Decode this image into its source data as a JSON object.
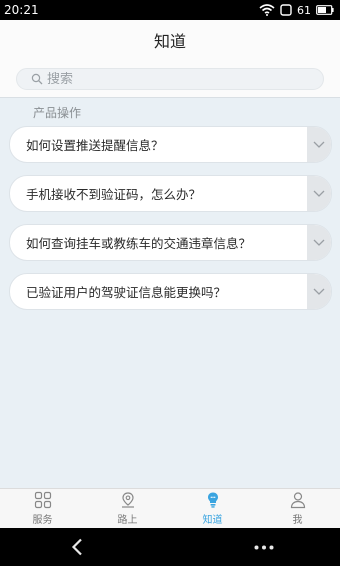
{
  "status_bar": {
    "time": "20:21",
    "battery": "61",
    "icons": [
      "wifi-icon",
      "screen-icon",
      "battery-icon"
    ]
  },
  "header": {
    "title": "知道"
  },
  "search": {
    "placeholder": "搜索",
    "icon": "search-icon"
  },
  "section": {
    "label": "产品操作"
  },
  "faq": [
    {
      "question": "如何设置推送提醒信息？"
    },
    {
      "question": "手机接收不到验证码，怎么办？"
    },
    {
      "question": "如何查询挂车或教练车的交通违章信息？"
    },
    {
      "question": "已验证用户的驾驶证信息能更换吗？"
    }
  ],
  "tabs": [
    {
      "label": "服务",
      "icon": "grid-icon",
      "active": false
    },
    {
      "label": "路上",
      "icon": "location-icon",
      "active": false
    },
    {
      "label": "知道",
      "icon": "bulb-icon",
      "active": true
    },
    {
      "label": "我",
      "icon": "person-icon",
      "active": false
    }
  ],
  "colors": {
    "accent": "#3aa4e0",
    "background": "#e9f0f5"
  }
}
